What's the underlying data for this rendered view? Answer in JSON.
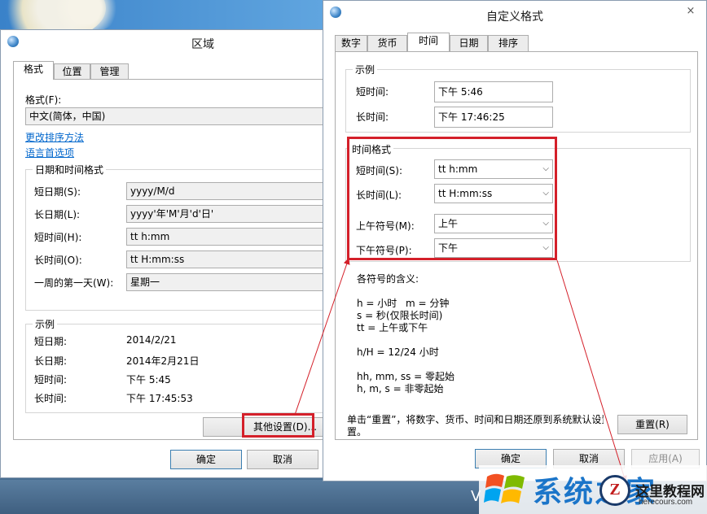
{
  "region": {
    "title": "区域",
    "tabs": [
      "格式",
      "位置",
      "管理"
    ],
    "format_label": "格式(F):",
    "format_value": "中文(简体，中国)",
    "link_sort": "更改排序方法",
    "link_language": "语言首选项",
    "datetime_group": "日期和时间格式",
    "rows": [
      {
        "label": "短日期(S):",
        "value": "yyyy/M/d"
      },
      {
        "label": "长日期(L):",
        "value": "yyyy'年'M'月'd'日'"
      },
      {
        "label": "短时间(H):",
        "value": "tt h:mm"
      },
      {
        "label": "长时间(O):",
        "value": "tt H:mm:ss"
      },
      {
        "label": "一周的第一天(W):",
        "value": "星期一"
      }
    ],
    "example_group": "示例",
    "examples": [
      {
        "label": "短日期:",
        "value": "2014/2/21"
      },
      {
        "label": "长日期:",
        "value": "2014年2月21日"
      },
      {
        "label": "短时间:",
        "value": "下午 5:45"
      },
      {
        "label": "长时间:",
        "value": "下午 17:45:53"
      }
    ],
    "other_settings": "其他设置(D)...",
    "ok": "确定",
    "cancel": "取消"
  },
  "custom": {
    "title": "自定义格式",
    "close": "×",
    "tabs": [
      "数字",
      "货币",
      "时间",
      "日期",
      "排序"
    ],
    "example_group": "示例",
    "short_label": "短时间:",
    "short_value": "下午 5:46",
    "long_label": "长时间:",
    "long_value": "下午 17:46:25",
    "format_group": "时间格式",
    "selects": [
      {
        "label": "短时间(S):",
        "value": "tt h:mm"
      },
      {
        "label": "长时间(L):",
        "value": "tt H:mm:ss"
      },
      {
        "label": "上午符号(M):",
        "value": "上午"
      },
      {
        "label": "下午符号(P):",
        "value": "下午"
      }
    ],
    "meaning_title": "各符号的含义:",
    "meaning_1a": "h = 小时",
    "meaning_1b": "m = 分钟",
    "meaning_2": "s = 秒(仅限长时间)",
    "meaning_3": "tt = 上午或下午",
    "meaning_4": "h/H = 12/24 小时",
    "meaning_5": "hh, mm, ss = 零起始",
    "meaning_6": "h, m, s = 非零起始",
    "reset_note_1": "单击“重置”，将数字、货币、时间和日期还原到系统默认设置。",
    "reset_note_2": "置。",
    "reset": "重置(R)",
    "ok": "确定",
    "cancel": "取消",
    "apply": "应用(A)"
  },
  "watermark": {
    "brand": "系统之家",
    "circle": "Z",
    "site": "这里教程网",
    "url": "herecours.com"
  },
  "colors": {
    "highlight": "#d4202a",
    "link": "#0066cc",
    "brand": "#1b75c9"
  }
}
